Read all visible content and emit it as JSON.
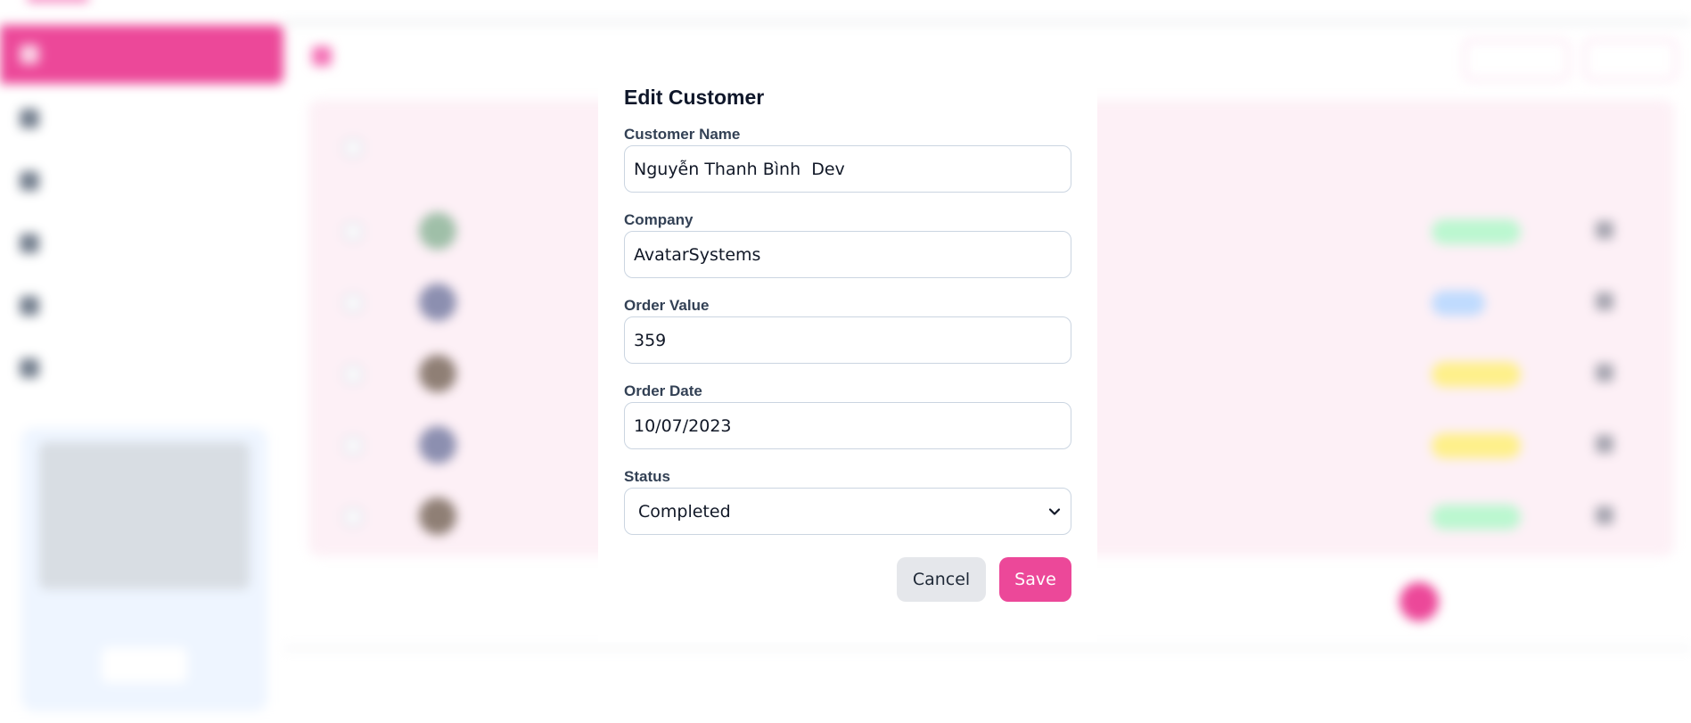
{
  "modal": {
    "title": "Edit Customer",
    "fields": {
      "customer_name": {
        "label": "Customer Name",
        "value": "Nguyễn Thanh Bình  Dev"
      },
      "company": {
        "label": "Company",
        "value": "AvatarSystems"
      },
      "order_value": {
        "label": "Order Value",
        "value": "359"
      },
      "order_date": {
        "label": "Order Date",
        "value": "10/07/2023"
      },
      "status": {
        "label": "Status",
        "value": "Completed",
        "icon": "chevron-down-icon"
      }
    },
    "cancel_label": "Cancel",
    "save_label": "Save"
  },
  "colors": {
    "accent": "#ec4899",
    "cancel_bg": "#e5e7eb",
    "table_bg": "#fdf0f6",
    "promo_bg": "#eef5ff",
    "status_completed": "#bbf7d0",
    "status_new": "#bfdbfe",
    "status_in_progress": "#fef08a"
  }
}
